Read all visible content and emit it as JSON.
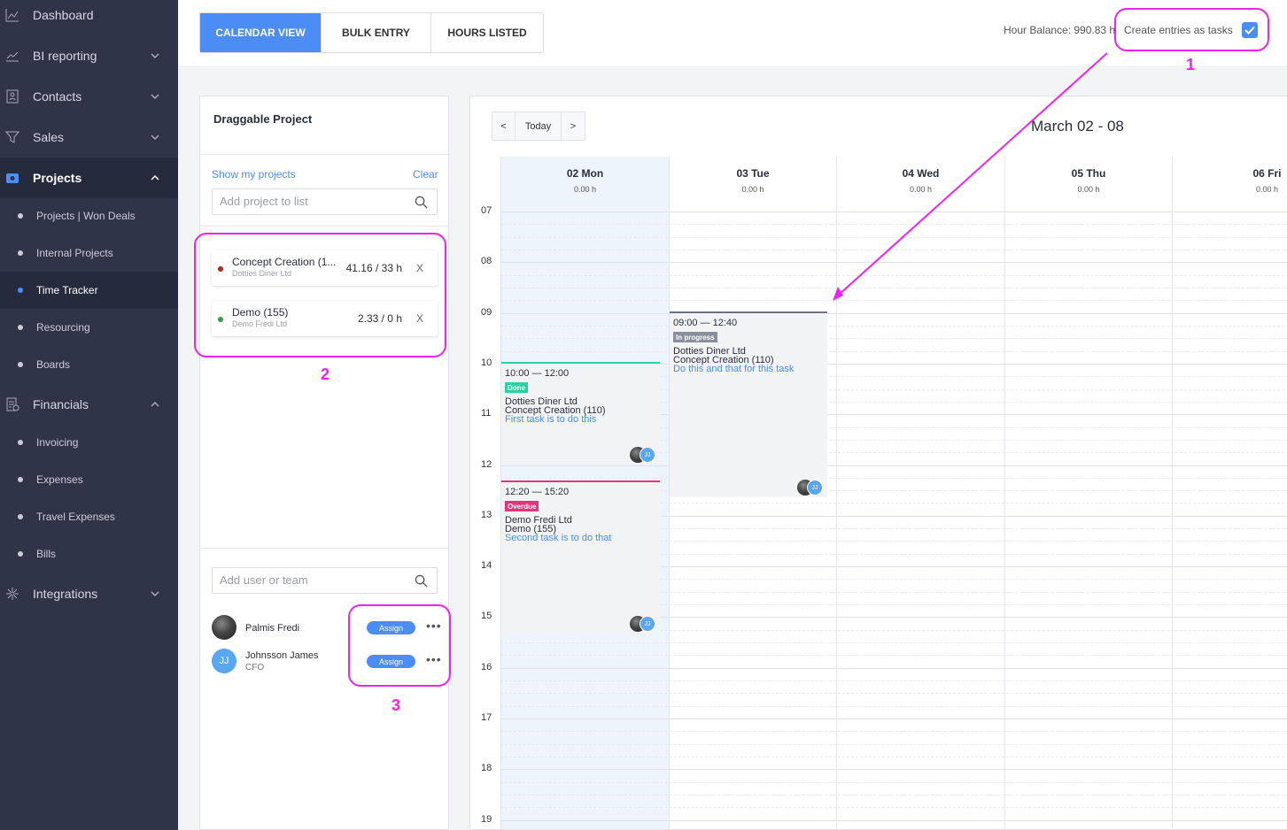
{
  "sidebar": {
    "items": [
      {
        "label": "Dashboard",
        "icon": "chart-icon"
      },
      {
        "label": "BI reporting",
        "icon": "trend-icon"
      },
      {
        "label": "Contacts",
        "icon": "contacts-icon"
      },
      {
        "label": "Sales",
        "icon": "funnel-icon"
      },
      {
        "label": "Projects",
        "icon": "projects-icon"
      },
      {
        "label": "Financials",
        "icon": "invoice-icon"
      },
      {
        "label": "Integrations",
        "icon": "integrations-icon"
      }
    ],
    "projects_sub": [
      "Projects | Won Deals",
      "Internal Projects",
      "Time Tracker",
      "Resourcing",
      "Boards"
    ],
    "financials_sub": [
      "Invoicing",
      "Expenses",
      "Travel Expenses",
      "Bills"
    ]
  },
  "tabs": [
    "CALENDAR VIEW",
    "BULK ENTRY",
    "HOURS LISTED"
  ],
  "header": {
    "hour_balance": "Hour Balance: 990.83 h",
    "create_tasks_label": "Create entries as tasks",
    "create_tasks_checked": true
  },
  "panel": {
    "title": "Draggable Project",
    "show_my_projects": "Show my projects",
    "clear": "Clear",
    "project_search_placeholder": "Add project to list",
    "projects": [
      {
        "name": "Concept Creation (1...",
        "client": "Dotties Diner Ltd",
        "hours": "41.16 / 33 h",
        "remove": "X",
        "color": "#b3261e"
      },
      {
        "name": "Demo (155)",
        "client": "Demo Fredi Ltd",
        "hours": "2.33 / 0 h",
        "remove": "X",
        "color": "#2e9e3e"
      }
    ],
    "user_search_placeholder": "Add user or team",
    "users": [
      {
        "name": "Palmis Fredi",
        "role": "",
        "initials": "",
        "assign": "Assign",
        "more": "•••"
      },
      {
        "name": "Johnsson James",
        "role": "CFO",
        "initials": "JJ",
        "assign": "Assign",
        "more": "•••"
      }
    ]
  },
  "calendar": {
    "prev": "<",
    "today": "Today",
    "next": ">",
    "title": "March 02 - 08",
    "days": [
      {
        "name": "02 Mon",
        "hours": "0.00 h"
      },
      {
        "name": "03 Tue",
        "hours": "0.00 h"
      },
      {
        "name": "04 Wed",
        "hours": "0.00 h"
      },
      {
        "name": "05 Thu",
        "hours": "0.00 h"
      },
      {
        "name": "06 Fri",
        "hours": "0.00 h"
      }
    ],
    "hours": [
      "07",
      "08",
      "09",
      "10",
      "11",
      "12",
      "13",
      "14",
      "15",
      "16",
      "17",
      "18",
      "19"
    ],
    "events": [
      {
        "time": "10:00 — 12:00",
        "status": "Done",
        "status_color": "#2bd1a0",
        "border_color": "#2bd1a0",
        "client": "Dotties Diner Ltd",
        "project": "Concept Creation (110)",
        "task": "First task is to do this",
        "avatar_initials": "JJ"
      },
      {
        "time": "12:20 — 15:20",
        "status": "Overdue",
        "status_color": "#e8337a",
        "border_color": "#e8337a",
        "client": "Demo Fredi Ltd",
        "project": "Demo (155)",
        "task": "Second task is to do that",
        "avatar_initials": "JJ"
      },
      {
        "time": "09:00 — 12:40",
        "status": "In progress",
        "status_color": "#8a8f9c",
        "border_color": "#6b7183",
        "client": "Dotties Diner Ltd",
        "project": "Concept Creation (110)",
        "task": "Do this and that for this task",
        "avatar_initials": "JJ"
      }
    ]
  },
  "annotations": [
    "1",
    "2",
    "3"
  ]
}
